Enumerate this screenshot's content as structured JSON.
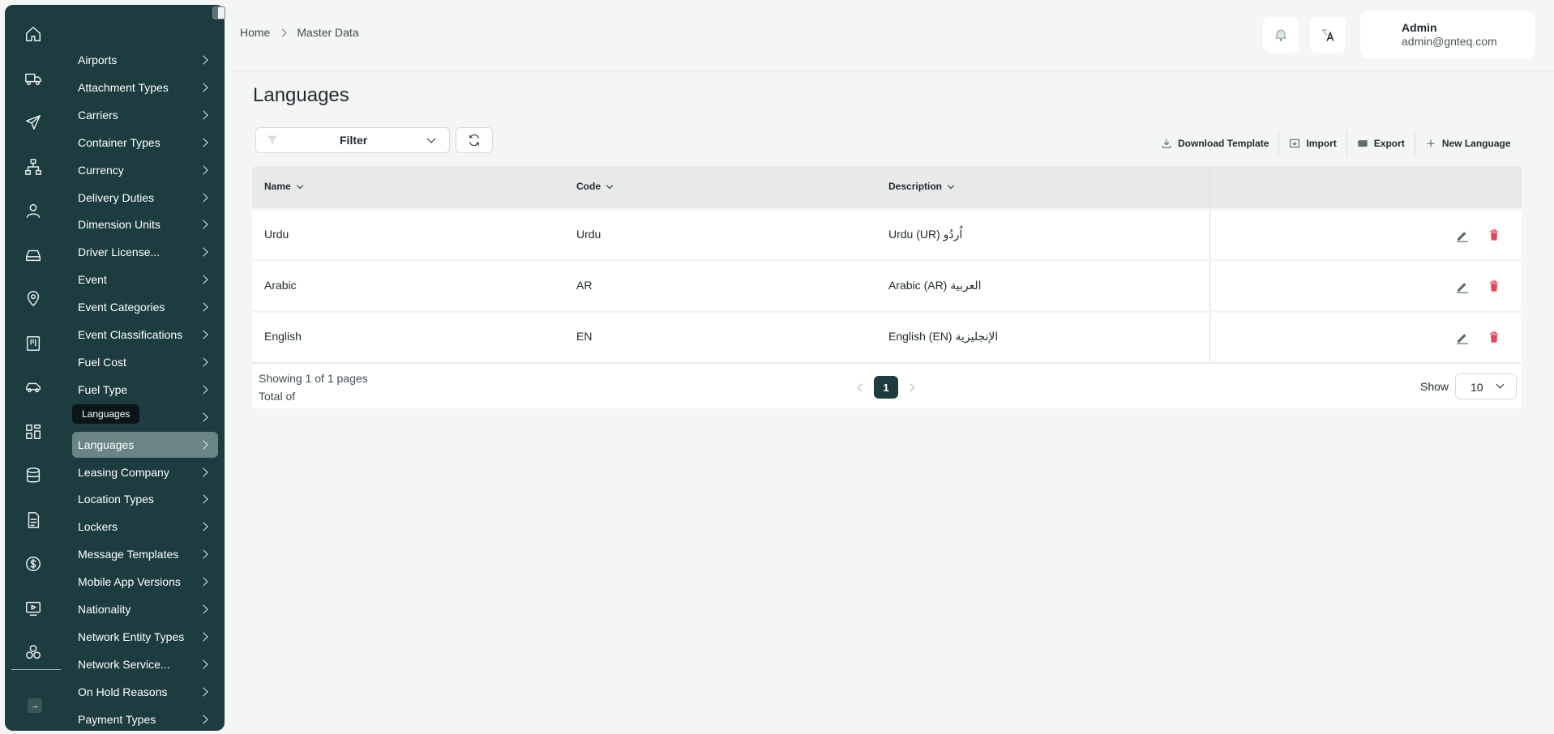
{
  "sidebar": {
    "rail_icons": [
      "home-icon",
      "truck-icon",
      "plane-icon",
      "hierarchy-icon",
      "user-icon",
      "storage-icon",
      "location-icon",
      "board-icon",
      "car-icon",
      "apps-icon",
      "database-icon",
      "document-icon",
      "dollar-icon",
      "monitor-icon",
      "network-icon"
    ],
    "items": [
      {
        "label": "Airports"
      },
      {
        "label": "Attachment Types"
      },
      {
        "label": "Carriers"
      },
      {
        "label": "Container Types"
      },
      {
        "label": "Currency"
      },
      {
        "label": "Delivery Duties"
      },
      {
        "label": "Dimension Units"
      },
      {
        "label": "Driver License..."
      },
      {
        "label": "Event"
      },
      {
        "label": "Event Categories"
      },
      {
        "label": "Event Classifications"
      },
      {
        "label": "Fuel Cost"
      },
      {
        "label": "Fuel Type"
      },
      {
        "label": ""
      },
      {
        "label": "Languages"
      },
      {
        "label": "Leasing Company"
      },
      {
        "label": "Location Types"
      },
      {
        "label": "Lockers"
      },
      {
        "label": "Message Templates"
      },
      {
        "label": "Mobile App Versions"
      },
      {
        "label": "Nationality"
      },
      {
        "label": "Network Entity Types"
      },
      {
        "label": "Network Service..."
      },
      {
        "label": "On Hold Reasons"
      },
      {
        "label": "Payment Types"
      }
    ],
    "tooltip": "Languages",
    "active_index": 14
  },
  "header": {
    "breadcrumb": [
      "Home",
      "Master Data"
    ],
    "user_name": "Admin",
    "user_email": "admin@gnteq.com"
  },
  "page": {
    "title": "Languages",
    "filter_label": "Filter",
    "actions": {
      "download": "Download Template",
      "import": "Import",
      "export": "Export",
      "new": "New Language"
    }
  },
  "table": {
    "columns": [
      "Name",
      "Code",
      "Description"
    ],
    "rows": [
      {
        "name": "Urdu",
        "code": "Urdu",
        "description": "Urdu (UR) اُردُو"
      },
      {
        "name": "Arabic",
        "code": "AR",
        "description": "Arabic (AR) العربية"
      },
      {
        "name": "English",
        "code": "EN",
        "description": "English (EN) الإنجليزية"
      }
    ]
  },
  "pagination": {
    "showing": "Showing 1 of 1 pages",
    "total": "Total of",
    "current_page": "1",
    "show_label": "Show",
    "page_size": "10"
  },
  "colors": {
    "sidebar_bg": "#1c3c3f",
    "active_item": "#6b8486",
    "delete": "#e0455b"
  }
}
